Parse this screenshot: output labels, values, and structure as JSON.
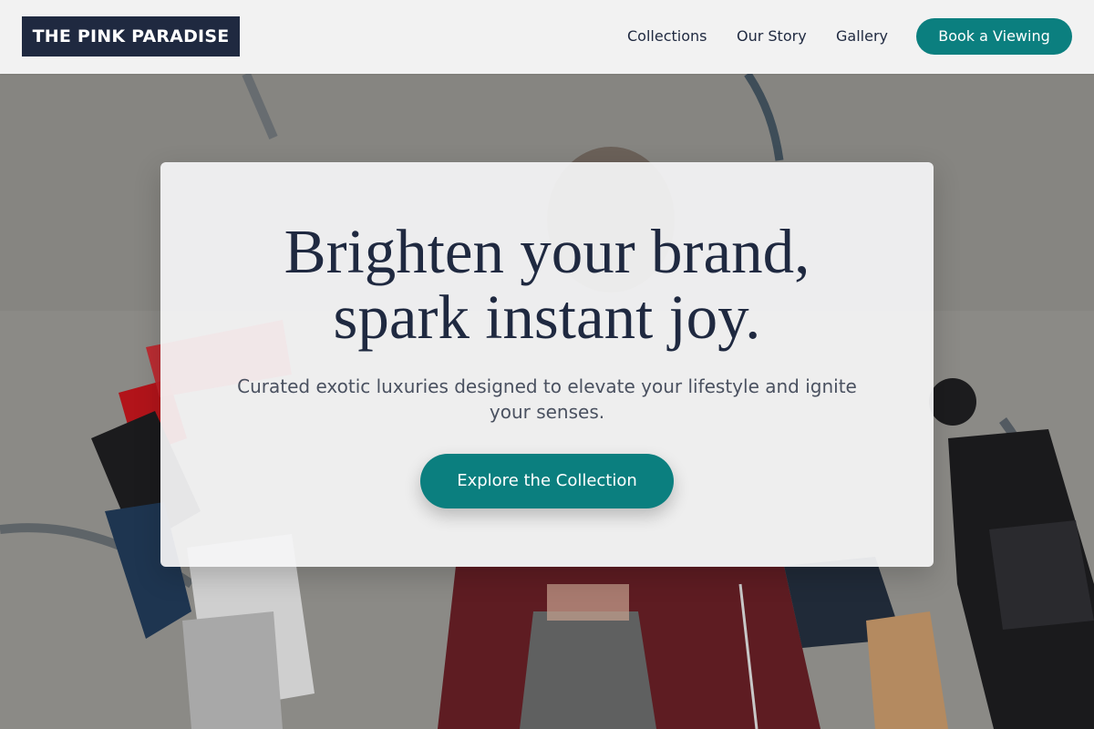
{
  "header": {
    "logo": "THE PINK PARADISE",
    "nav": {
      "collections": "Collections",
      "our_story": "Our Story",
      "gallery": "Gallery"
    },
    "book_button": "Book a Viewing"
  },
  "hero": {
    "headline_line1": "Brighten your brand,",
    "headline_line2": "spark instant joy.",
    "subtext": "Curated exotic luxuries designed to elevate your lifestyle and ignite your senses.",
    "cta": "Explore the Collection",
    "background": "woman-holding-shopping-bags-photo"
  },
  "colors": {
    "navy": "#1f2940",
    "teal": "#0b7f7f",
    "header_bg": "#f2f2f2",
    "card_bg": "#f5f5f6"
  }
}
